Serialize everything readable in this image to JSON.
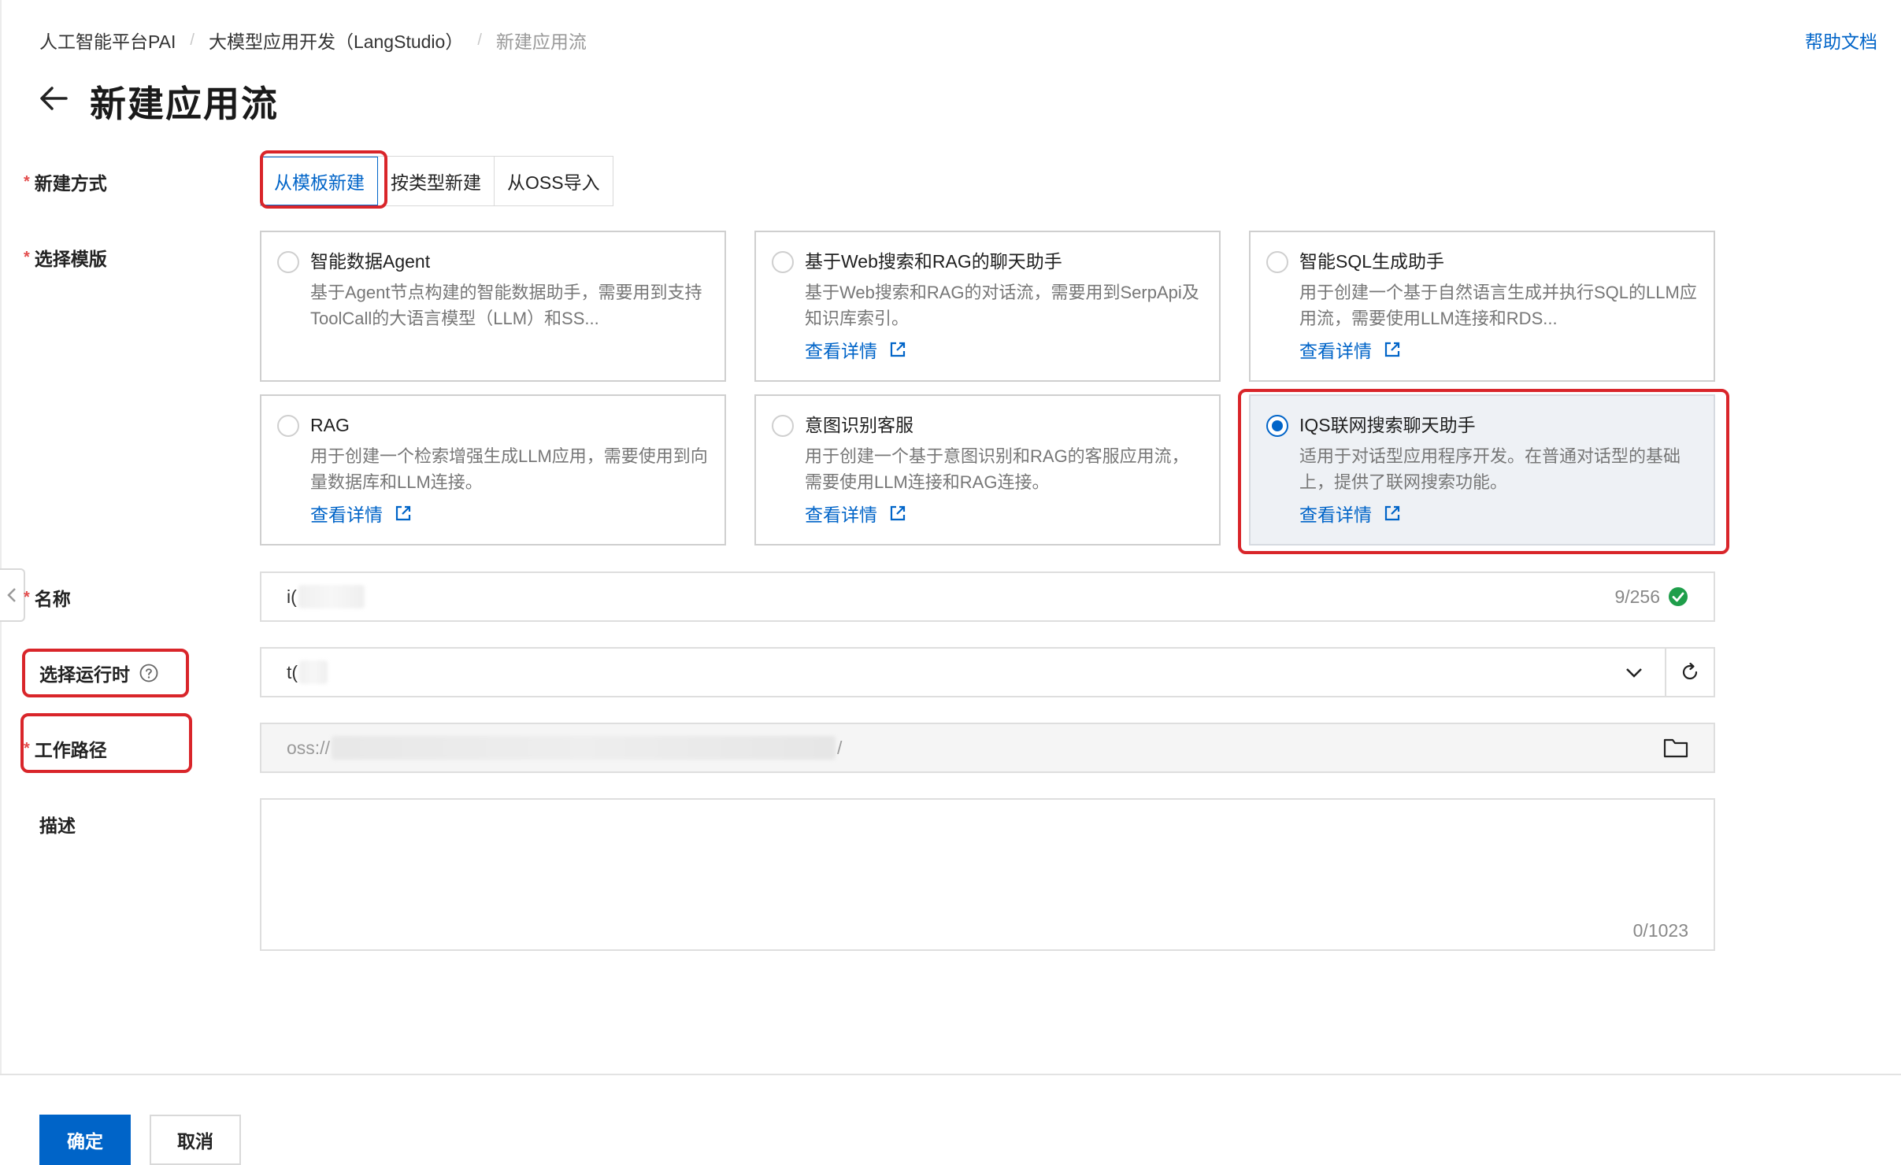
{
  "breadcrumb": {
    "items": [
      "人工智能平台PAI",
      "大模型应用开发（LangStudio）",
      "新建应用流"
    ]
  },
  "help_link": "帮助文档",
  "page": {
    "title": "新建应用流"
  },
  "form": {
    "create_method": {
      "label": "新建方式",
      "required": "*",
      "options": [
        "从模板新建",
        "按类型新建",
        "从OSS导入"
      ],
      "selected": "从模板新建"
    },
    "template": {
      "label": "选择模版",
      "required": "*",
      "more_label": "查看详情",
      "cards": [
        {
          "title": "智能数据Agent",
          "desc": "基于Agent节点构建的智能数据助手，需要用到支持ToolCall的大语言模型（LLM）和SS...",
          "has_more": false,
          "selected": false
        },
        {
          "title": "基于Web搜索和RAG的聊天助手",
          "desc": "基于Web搜索和RAG的对话流，需要用到SerpApi及知识库索引。",
          "has_more": true,
          "selected": false
        },
        {
          "title": "智能SQL生成助手",
          "desc": "用于创建一个基于自然语言生成并执行SQL的LLM应用流，需要使用LLM连接和RDS...",
          "has_more": true,
          "selected": false
        },
        {
          "title": "RAG",
          "desc": "用于创建一个检索增强生成LLM应用，需要使用到向量数据库和LLM连接。",
          "has_more": true,
          "selected": false
        },
        {
          "title": "意图识别客服",
          "desc": "用于创建一个基于意图识别和RAG的客服应用流，需要使用LLM连接和RAG连接。",
          "has_more": true,
          "selected": false
        },
        {
          "title": "IQS联网搜索聊天助手",
          "desc": "适用于对话型应用程序开发。在普通对话型的基础上，提供了联网搜索功能。",
          "has_more": true,
          "selected": true
        }
      ]
    },
    "name": {
      "label": "名称",
      "required": "*",
      "value": "i(",
      "counter": "9/256"
    },
    "runtime": {
      "label": "选择运行时",
      "value": "t("
    },
    "work_path": {
      "label": "工作路径",
      "required": "*",
      "value_prefix": "oss://",
      "value_suffix": "/"
    },
    "description": {
      "label": "描述",
      "value": "",
      "counter": "0/1023"
    }
  },
  "footer": {
    "confirm": "确定",
    "cancel": "取消"
  },
  "colors": {
    "primary": "#0064c8",
    "highlight": "#d9252a",
    "required": "#e34d4d",
    "success": "#1e9e4a"
  }
}
